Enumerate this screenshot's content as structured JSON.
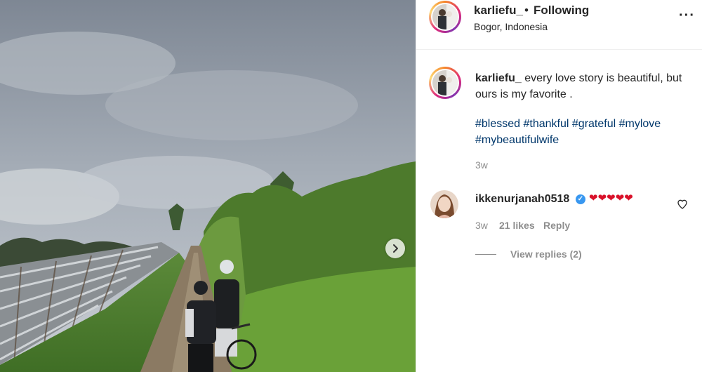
{
  "post": {
    "username": "karliefu_",
    "dot": "•",
    "following_label": "Following",
    "location": "Bogor, Indonesia",
    "more_icon": "more-horizontal-icon",
    "caption_text": "every love story is beautiful, but ours is my favorite .",
    "hashtags": [
      "#blessed",
      "#thankful",
      "#grateful",
      "#mylove",
      "#mybeautifulwife"
    ],
    "time_ago": "3w"
  },
  "comment": {
    "username": "ikkenurjanah0518",
    "verified_icon": "verified-badge-icon",
    "text": "❤❤❤❤❤",
    "time_ago": "3w",
    "likes": "21 likes",
    "reply_label": "Reply",
    "view_replies": "View replies (2)"
  },
  "media": {
    "next_icon": "chevron-right-icon"
  },
  "colors": {
    "link": "#00376b",
    "muted": "#8e8e8e",
    "verified": "#3897f0",
    "heart": "#d9112a"
  }
}
